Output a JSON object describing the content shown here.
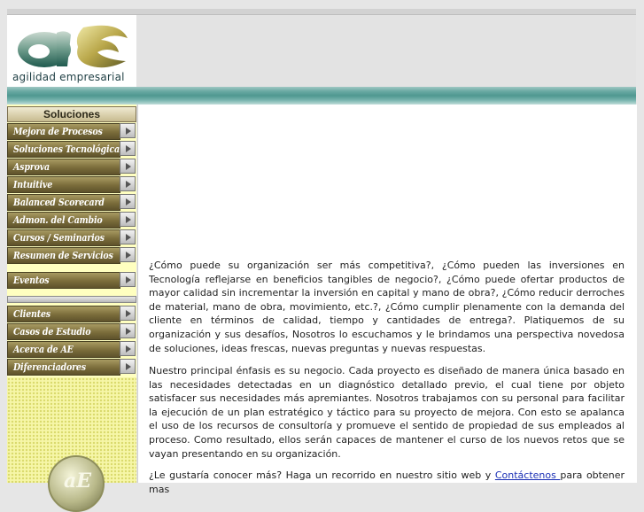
{
  "logo": {
    "tagline": "agilidad empresarial",
    "monogram": "aE"
  },
  "sidebar": {
    "header": "Soluciones",
    "items": [
      {
        "label": "Mejora de Procesos"
      },
      {
        "label": "Soluciones Tecnológicas"
      },
      {
        "label": "Asprova"
      },
      {
        "label": "Intuitive"
      },
      {
        "label": "Balanced Scorecard"
      },
      {
        "label": "Admon. del Cambio"
      },
      {
        "label": "Cursos / Seminarios"
      },
      {
        "label": "Resumen de Servicios"
      }
    ],
    "events": {
      "label": "Eventos"
    },
    "secondary": [
      {
        "label": "Clientes"
      },
      {
        "label": "Casos de Estudio"
      },
      {
        "label": "Acerca de AE"
      },
      {
        "label": "Diferenciadores"
      }
    ]
  },
  "content": {
    "p1": "¿Cómo puede su organización ser más competitiva?, ¿Cómo pueden las inversiones en Tecnología reflejarse en beneficios tangibles de negocio?,  ¿Cómo puede ofertar productos de mayor calidad sin incrementar la inversión en capital y mano de obra?, ¿Cómo reducir derroches de material, mano de obra, movimiento, etc.?, ¿Cómo cumplir plenamente con la demanda del cliente en términos de calidad, tiempo y cantidades de entrega?. Platiquemos de su organización y sus desafíos, Nosotros lo escuchamos y le brindamos una perspectiva novedosa de soluciones,  ideas frescas, nuevas preguntas y nuevas respuestas.",
    "p2": "Nuestro principal énfasis es su negocio. Cada proyecto es diseñado de manera única basado en las necesidades detectadas en un diagnóstico detallado previo, el cual tiene por objeto satisfacer sus necesidades más apremiantes. Nosotros trabajamos con su personal para facilitar la ejecución de un plan estratégico y táctico para su proyecto de mejora. Con esto se apalanca el uso de los recursos de consultoría y promueve el sentido de  propiedad de sus empleados al proceso. Como resultado, ellos serán capaces de mantener el curso de los nuevos retos que se vayan presentando en su organización.",
    "p3_before": "¿Le gustaría conocer más? Haga un recorrido en nuestro sitio web y ",
    "p3_link": "Contáctenos ",
    "p3_after": "para obtener mas"
  },
  "colors": {
    "teal_bar": "#4f9890",
    "sidebar_bg": "#ffffc0",
    "nav_button": "#7a6c3a",
    "link": "#1a2fb5"
  }
}
